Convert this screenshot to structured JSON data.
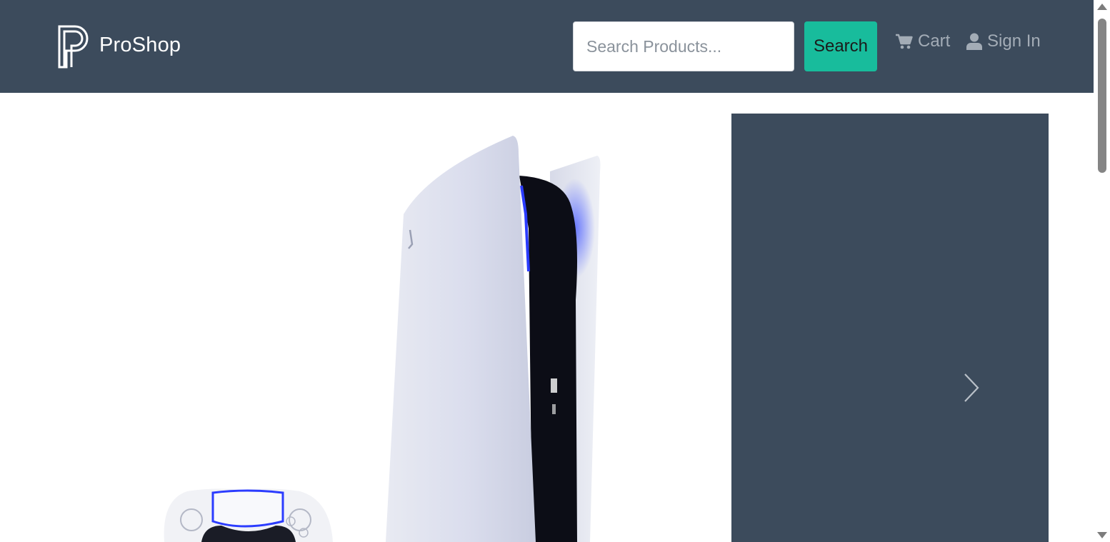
{
  "brand": {
    "name": "ProShop",
    "logo_icon": "proshop-logo-icon"
  },
  "search": {
    "placeholder": "Search Products...",
    "value": "",
    "button_label": "Search"
  },
  "nav": {
    "cart": {
      "label": "Cart",
      "icon": "cart-icon"
    },
    "signin": {
      "label": "Sign In",
      "icon": "user-icon"
    }
  },
  "hero": {
    "image": "playstation-5-console-image"
  },
  "carousel": {
    "next_icon": "chevron-right-icon"
  },
  "colors": {
    "navbar": "#3c4b5c",
    "accent": "#18bc9c",
    "nav_link": "#a3acb6"
  }
}
